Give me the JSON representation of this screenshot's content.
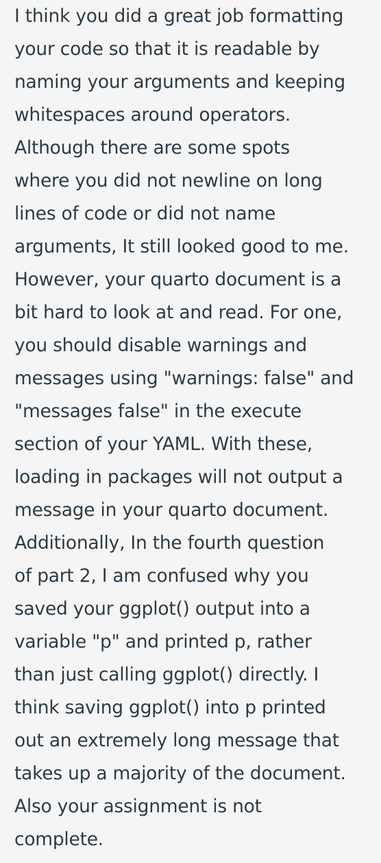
{
  "comment": {
    "lines": [
      "I think you did a great job formatting",
      "your code so that it is readable by",
      "naming your arguments and keeping",
      "whitespaces around operators.",
      "Although there are some spots",
      "where you did not newline on long",
      "lines of code or did not name",
      "arguments, It still looked good to me.",
      "However, your quarto document is a",
      "bit hard to look at and read. For one,",
      "you should disable warnings and",
      "messages using \"warnings: false\" and",
      "\"messages false\" in the execute",
      "section of your YAML. With these,",
      "loading in packages will not output a",
      "message in your quarto document.",
      "Additionally, In the fourth question",
      "of part 2, I am confused why you",
      "saved your ggplot() output into a",
      "variable \"p\" and printed p, rather",
      "than just calling ggplot() directly. I",
      "think saving ggplot() into p printed",
      "out an extremely long message that",
      "takes up a majority of the document.",
      "Also your assignment is not",
      "complete."
    ]
  }
}
